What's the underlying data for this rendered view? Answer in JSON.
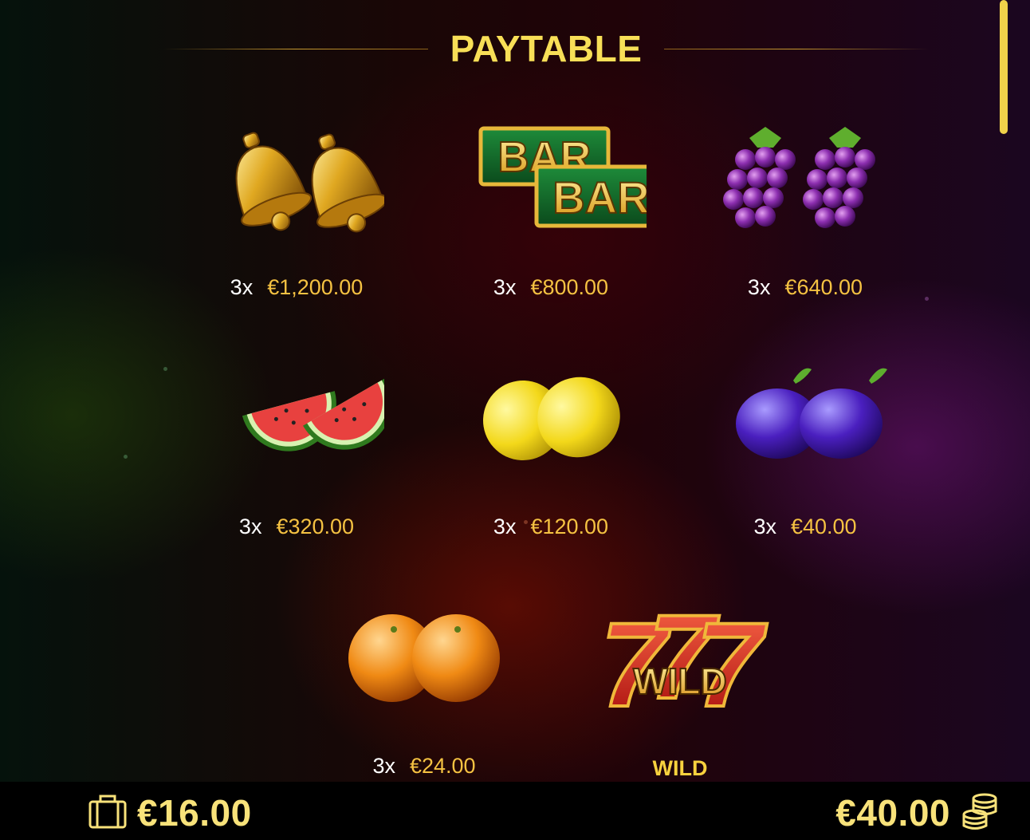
{
  "header": {
    "title": "PAYTABLE"
  },
  "symbols": [
    {
      "id": "bell",
      "multiplier": "3x",
      "amount": "€1,200.00"
    },
    {
      "id": "bar",
      "multiplier": "3x",
      "amount": "€800.00",
      "art_text": "BAR"
    },
    {
      "id": "grapes",
      "multiplier": "3x",
      "amount": "€640.00"
    },
    {
      "id": "watermelon",
      "multiplier": "3x",
      "amount": "€320.00"
    },
    {
      "id": "lemon",
      "multiplier": "3x",
      "amount": "€120.00"
    },
    {
      "id": "plum",
      "multiplier": "3x",
      "amount": "€40.00"
    },
    {
      "id": "orange",
      "multiplier": "3x",
      "amount": "€24.00"
    },
    {
      "id": "wild",
      "label": "WILD",
      "art_text": "WILD"
    }
  ],
  "footer": {
    "balance": "€16.00",
    "balance_icon": "wallet-icon",
    "bet": "€40.00",
    "bet_icon": "coin-stack-icon"
  },
  "colors": {
    "title": "#f8df57",
    "amount": "#f5c242",
    "multiplier": "#ffffff",
    "footer_text": "#f8e27a"
  }
}
